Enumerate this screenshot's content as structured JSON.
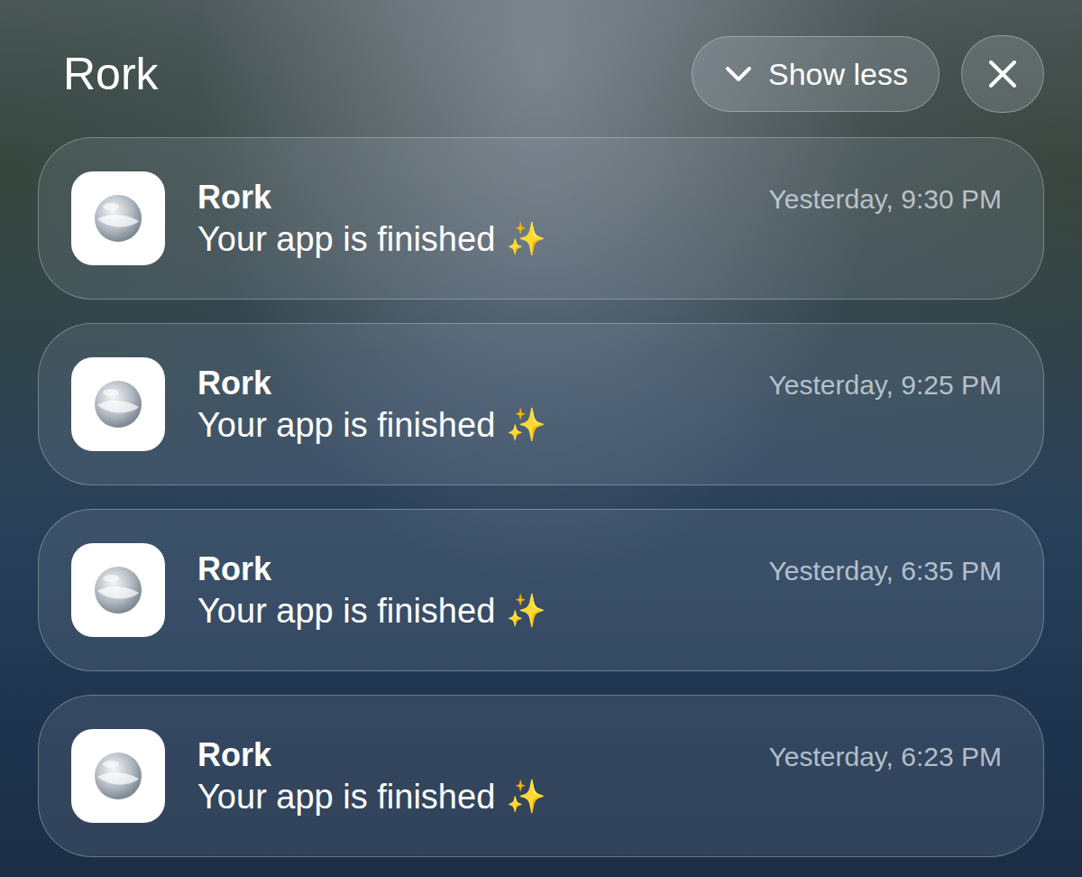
{
  "group": {
    "title": "Rork"
  },
  "controls": {
    "show_less": {
      "label": "Show less"
    }
  },
  "notifications": [
    {
      "app": "Rork",
      "message": "Your app is finished",
      "emoji": "✨",
      "time": "Yesterday, 9:30 PM"
    },
    {
      "app": "Rork",
      "message": "Your app is finished",
      "emoji": "✨",
      "time": "Yesterday, 9:25 PM"
    },
    {
      "app": "Rork",
      "message": "Your app is finished",
      "emoji": "✨",
      "time": "Yesterday, 6:35 PM"
    },
    {
      "app": "Rork",
      "message": "Your app is finished",
      "emoji": "✨",
      "time": "Yesterday, 6:23 PM"
    }
  ]
}
